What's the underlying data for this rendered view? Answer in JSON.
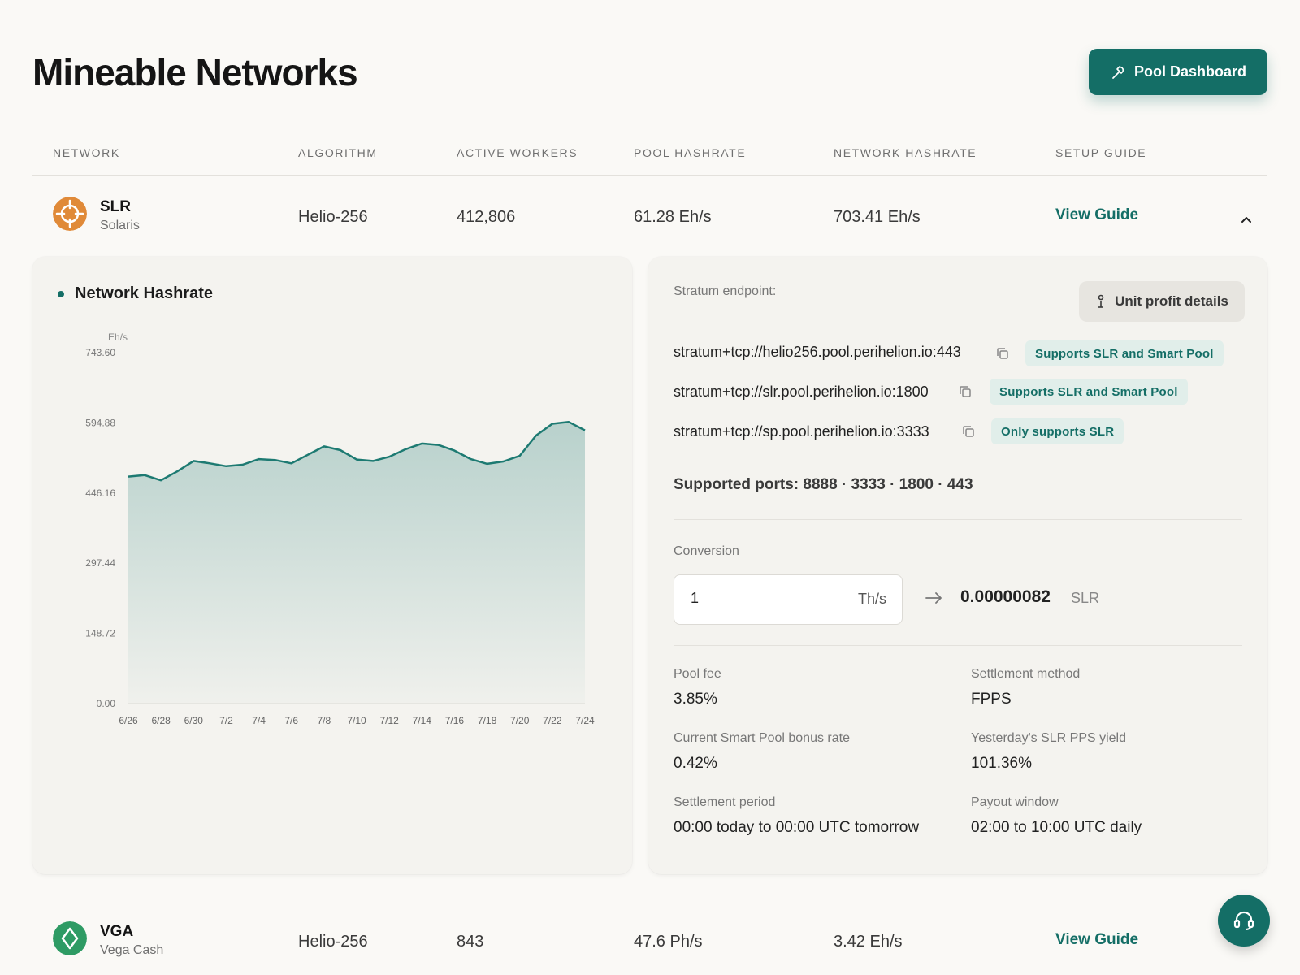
{
  "page": {
    "title": "Mineable Networks",
    "pool_dashboard_label": "Pool Dashboard"
  },
  "table": {
    "headers": [
      "NETWORK",
      "ALGORITHM",
      "ACTIVE WORKERS",
      "POOL HASHRATE",
      "NETWORK HASHRATE",
      "SETUP GUIDE"
    ],
    "rows": [
      {
        "symbol": "SLR",
        "name": "Solaris",
        "algorithm": "Helio-256",
        "active_workers": "412,806",
        "pool_hashrate": "61.28 Eh/s",
        "network_hashrate": "703.41 Eh/s",
        "guide_label": "View Guide",
        "icon": "sun-target-icon",
        "icon_color": "#e08a38",
        "expanded": true
      },
      {
        "symbol": "VGA",
        "name": "Vega Cash",
        "algorithm": "Helio-256",
        "active_workers": "843",
        "pool_hashrate": "47.6 Ph/s",
        "network_hashrate": "3.42 Eh/s",
        "guide_label": "View Guide",
        "icon": "diamond-icon",
        "icon_color": "#2e9b64",
        "expanded": false
      }
    ]
  },
  "chart_panel": {
    "title": "Network Hashrate"
  },
  "chart_data": {
    "type": "area",
    "title": "Network Hashrate",
    "ylabel": "Eh/s",
    "ylim": [
      0,
      743.6
    ],
    "yticks": [
      "743.60",
      "594.88",
      "446.16",
      "297.44",
      "148.72",
      "0.00"
    ],
    "ytick_values": [
      743.6,
      594.88,
      446.16,
      297.44,
      148.72,
      0
    ],
    "xticks": [
      "6/26",
      "6/28",
      "6/30",
      "7/2",
      "7/4",
      "7/6",
      "7/8",
      "7/10",
      "7/12",
      "7/14",
      "7/16",
      "7/18",
      "7/20",
      "7/22",
      "7/24"
    ],
    "x": [
      "6/26",
      "6/27",
      "6/28",
      "6/29",
      "6/30",
      "7/1",
      "7/2",
      "7/3",
      "7/4",
      "7/5",
      "7/6",
      "7/7",
      "7/8",
      "7/9",
      "7/10",
      "7/11",
      "7/12",
      "7/13",
      "7/14",
      "7/15",
      "7/16",
      "7/17",
      "7/18",
      "7/19",
      "7/20",
      "7/21",
      "7/22",
      "7/23",
      "7/24"
    ],
    "values": [
      481,
      484,
      473,
      492,
      514,
      509,
      503,
      506,
      518,
      516,
      509,
      527,
      545,
      537,
      517,
      514,
      523,
      539,
      551,
      548,
      536,
      518,
      508,
      513,
      525,
      568,
      593,
      597,
      579
    ],
    "color": "#1d7a72"
  },
  "info_panel": {
    "stratum_label": "Stratum endpoint:",
    "profit_button_label": "Unit profit details",
    "endpoints": [
      {
        "url": "stratum+tcp://helio256.pool.perihelion.io:443",
        "tag": "Supports SLR and Smart Pool"
      },
      {
        "url": "stratum+tcp://slr.pool.perihelion.io:1800",
        "tag": "Supports SLR and Smart Pool"
      },
      {
        "url": "stratum+tcp://sp.pool.perihelion.io:3333",
        "tag": "Only supports SLR"
      }
    ],
    "ports_text": "Supported ports: 8888 · 3333 · 1800 · 443",
    "conversion_label": "Conversion",
    "conversion_input_value": "1",
    "conversion_input_unit": "Th/s",
    "conversion_result": "0.00000082",
    "conversion_result_unit": "SLR",
    "stats": [
      {
        "label": "Pool fee",
        "value": "3.85%"
      },
      {
        "label": "Settlement method",
        "value": "FPPS"
      },
      {
        "label": "Current Smart Pool bonus rate",
        "value": "0.42%"
      },
      {
        "label": "Yesterday's SLR PPS yield",
        "value": "101.36%"
      },
      {
        "label": "Settlement period",
        "value": "00:00 today to 00:00 UTC tomorrow"
      },
      {
        "label": "Payout window",
        "value": "02:00 to 10:00 UTC daily"
      }
    ]
  },
  "colors": {
    "brand": "#146e66",
    "tag_bg": "#e1eeea"
  }
}
